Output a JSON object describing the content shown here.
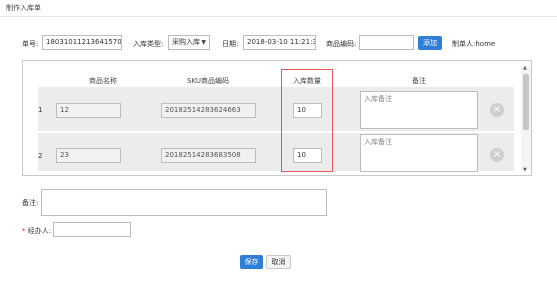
{
  "page": {
    "title": "制作入库单"
  },
  "form": {
    "order_no_label": "单号:",
    "order_no_value": "1803101121364157033",
    "type_label": "入库类型:",
    "type_value": "采购入库",
    "date_label": "日期:",
    "date_value": "2018-03-10 11:21:36",
    "product_code_label": "商品编码:",
    "product_code_value": "",
    "add_button": "添加",
    "maker_label": "制单人:",
    "maker_value": "home"
  },
  "table": {
    "columns": [
      "商品名称",
      "SKU商品编码",
      "入库数量",
      "备注"
    ],
    "rows": [
      {
        "index": "1",
        "name": "12",
        "sku": "20182514283624663",
        "qty": "10",
        "remark_placeholder": "入库备注"
      },
      {
        "index": "2",
        "name": "23",
        "sku": "20182514283683508",
        "qty": "10",
        "remark_placeholder": "入库备注"
      }
    ]
  },
  "footer": {
    "remark_label": "备注:",
    "remark_value": "",
    "handler_required": "*",
    "handler_label": "经办人:",
    "handler_value": "",
    "save_button": "保存",
    "cancel_button": "取消"
  },
  "colors": {
    "accent": "#2f7ed8",
    "highlight": "#e05a5a",
    "required": "#e02020"
  },
  "icons": {
    "remove": "remove-circle-icon",
    "scroll_up": "arrow-up-icon",
    "scroll_down": "arrow-down-icon",
    "dropdown": "caret-down-icon"
  }
}
